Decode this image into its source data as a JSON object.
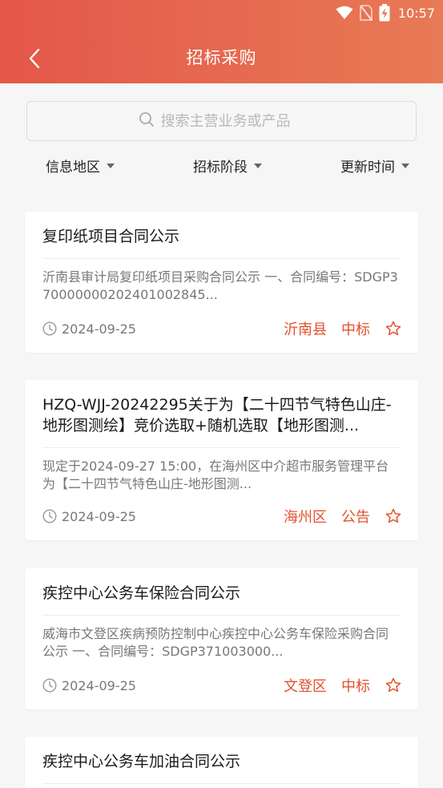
{
  "status_bar": {
    "time": "10:57"
  },
  "header": {
    "title": "招标采购"
  },
  "search": {
    "placeholder": "搜索主营业务或产品"
  },
  "filters": [
    {
      "label": "信息地区"
    },
    {
      "label": "招标阶段"
    },
    {
      "label": "更新时间"
    }
  ],
  "cards": [
    {
      "title": "复印纸项目合同公示",
      "desc": "沂南县审计局复印纸项目采购合同公示 一、合同编号：SDGP370000000202401002845...",
      "date": "2024-09-25",
      "region": "沂南县",
      "stage": "中标"
    },
    {
      "title": "HZQ-WJJ-20242295关于为【二十四节气特色山庄-地形图测绘】竞价选取+随机选取【地形图测...",
      "desc": "现定于2024-09-27 15:00，在海州区中介超市服务管理平台为【二十四节气特色山庄-地形图测...",
      "date": "2024-09-25",
      "region": "海州区",
      "stage": "公告"
    },
    {
      "title": "疾控中心公务车保险合同公示",
      "desc": "威海市文登区疾病预防控制中心疾控中心公务车保险采购合同公示 一、合同编号：SDGP371003000...",
      "date": "2024-09-25",
      "region": "文登区",
      "stage": "中标"
    },
    {
      "title": "疾控中心公务车加油合同公示"
    }
  ],
  "colors": {
    "accent": "#e2512e",
    "header_start": "#e4574a",
    "header_end": "#e87a55"
  }
}
